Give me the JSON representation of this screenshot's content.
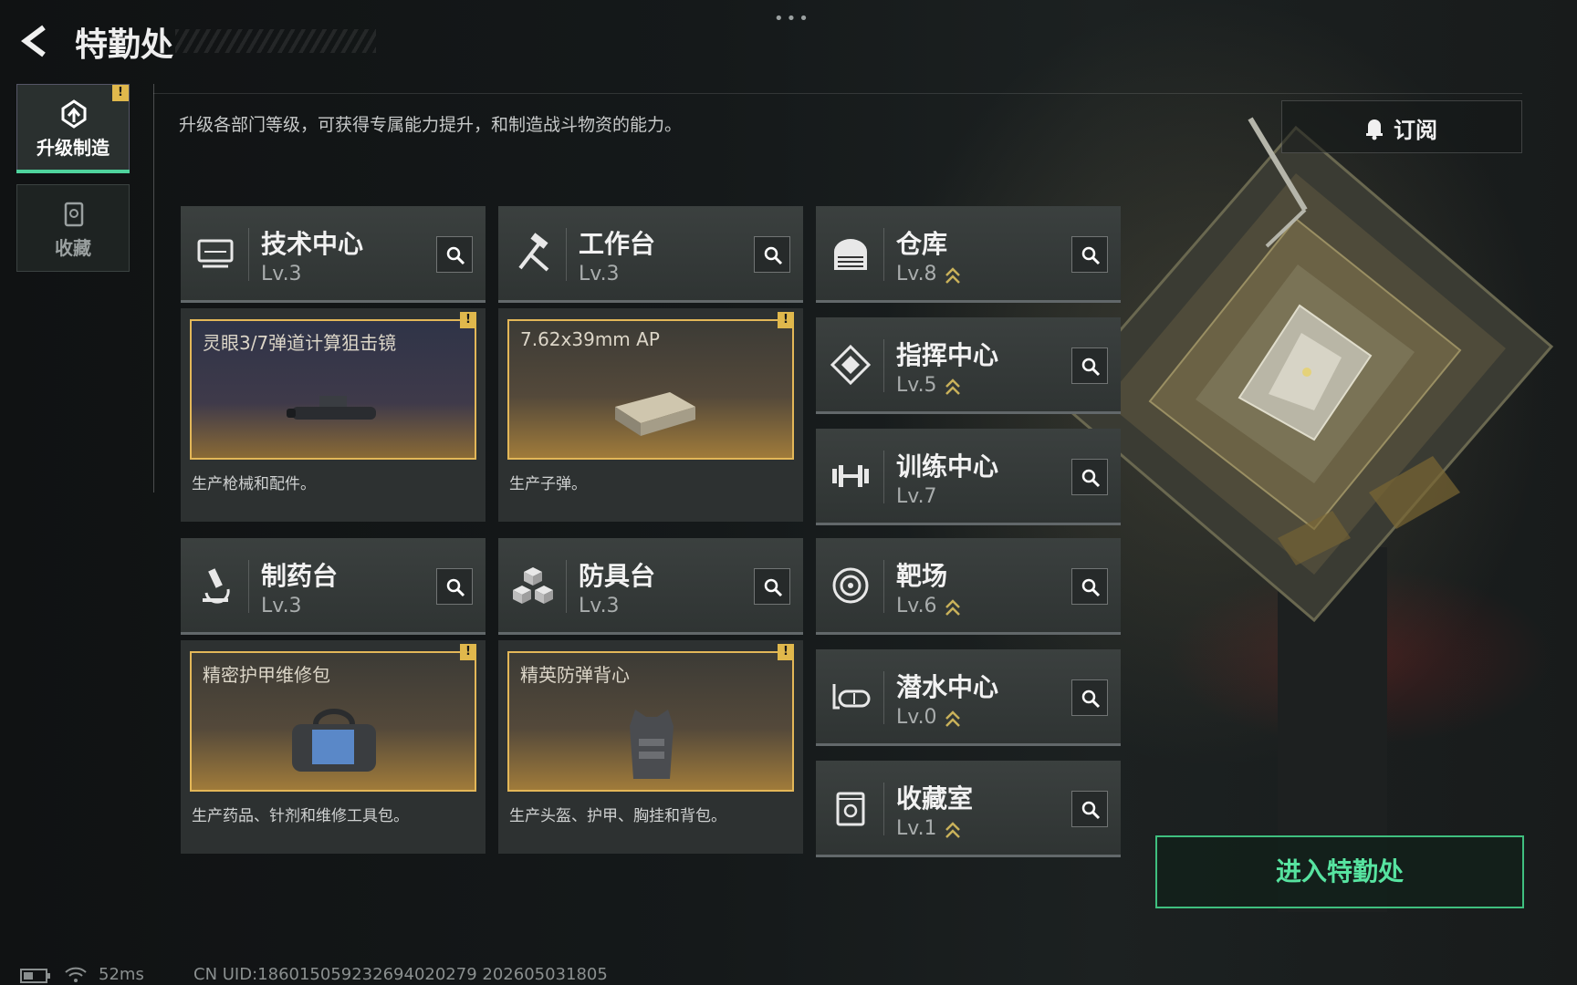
{
  "header": {
    "title": "特勤处",
    "menu_dots": "•••"
  },
  "rail": {
    "upgrade_label": "升级制造",
    "collect_label": "收藏",
    "alert_mark": "!"
  },
  "description": "升级各部门等级，可获得专属能力提升，和制造战斗物资的能力。",
  "subscribe": {
    "label": "订阅"
  },
  "departments": [
    {
      "name": "技术中心",
      "level": "Lv.3",
      "upgradable": false,
      "icon": "monitor-icon"
    },
    {
      "name": "工作台",
      "level": "Lv.3",
      "upgradable": false,
      "icon": "hammer-wrench-icon"
    },
    {
      "name": "仓库",
      "level": "Lv.8",
      "upgradable": true,
      "icon": "warehouse-icon"
    },
    {
      "name": "指挥中心",
      "level": "Lv.5",
      "upgradable": true,
      "icon": "command-icon"
    },
    {
      "name": "训练中心",
      "level": "Lv.7",
      "upgradable": false,
      "icon": "dumbbell-icon"
    },
    {
      "name": "制药台",
      "level": "Lv.3",
      "upgradable": false,
      "icon": "microscope-icon"
    },
    {
      "name": "防具台",
      "level": "Lv.3",
      "upgradable": false,
      "icon": "boxes-icon"
    },
    {
      "name": "靶场",
      "level": "Lv.6",
      "upgradable": true,
      "icon": "target-icon"
    },
    {
      "name": "潜水中心",
      "level": "Lv.0",
      "upgradable": true,
      "icon": "diving-mask-icon"
    },
    {
      "name": "收藏室",
      "level": "Lv.1",
      "upgradable": true,
      "icon": "collection-icon"
    }
  ],
  "production": [
    {
      "item": "灵眼3/7弹道计算狙击镜",
      "desc": "生产枪械和配件。",
      "icon": "scope-icon"
    },
    {
      "item": "7.62x39mm AP",
      "desc": "生产子弹。",
      "icon": "ammo-box-icon"
    },
    {
      "item": "精密护甲维修包",
      "desc": "生产药品、针剂和维修工具包。",
      "icon": "repair-bag-icon"
    },
    {
      "item": "精英防弹背心",
      "desc": "生产头盔、护甲、胸挂和背包。",
      "icon": "vest-icon"
    }
  ],
  "enter_button": {
    "label": "进入特勤处"
  },
  "footer": {
    "ping": "52ms",
    "uid": "CN UID:18601505923269402027​9 202605031805"
  },
  "colors": {
    "accent_green": "#4fd39d",
    "alert_yellow": "#e0b84c",
    "frame_gold": "#e3b758",
    "upgrade_arrow": "#c9b15a"
  }
}
